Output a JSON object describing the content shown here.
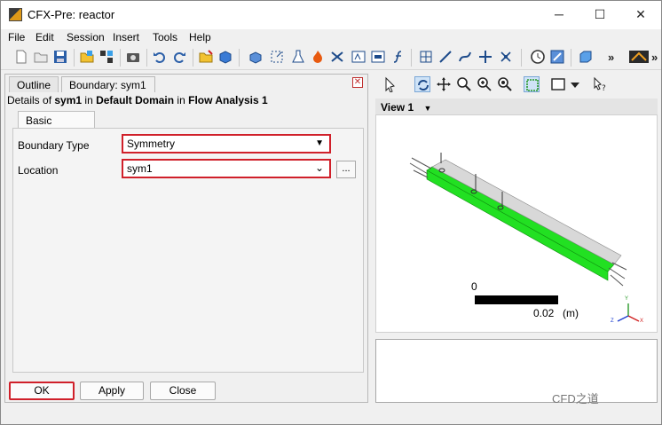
{
  "window": {
    "title": "CFX-Pre:  reactor",
    "minimize": "─",
    "maximize": "☐",
    "close": "✕"
  },
  "menu": [
    "File",
    "Edit",
    "Session",
    "Insert",
    "Tools",
    "Help"
  ],
  "toolbar": {
    "icons": [
      "new-file-icon",
      "open-folder-icon",
      "save-icon",
      "import-mesh-icon",
      "mesh-icon",
      "screenshot-icon",
      "undo-icon",
      "redo-icon",
      "open-results-icon",
      "package-icon",
      "domain-icon",
      "boundary-icon",
      "flask-icon",
      "flame-icon",
      "reaction-icon",
      "vector-icon",
      "subdomain-icon",
      "function-icon",
      "mesh-adapt-icon",
      "line-icon",
      "curve-icon",
      "point-icon",
      "transform-icon",
      "clock-icon",
      "solver-icon",
      "box-icon",
      "ansys-logo-icon"
    ],
    "more": "»"
  },
  "left": {
    "tabs": {
      "outline": "Outline",
      "boundary": "Boundary: sym1"
    },
    "close": "✕",
    "details": {
      "prefix": "Details of ",
      "object": "sym1",
      "in1": " in ",
      "domain": "Default Domain",
      "in2": " in ",
      "analysis": "Flow Analysis 1"
    },
    "inner_tab": "Basic Settings",
    "boundary_type_label": "Boundary Type",
    "boundary_type_value": "Symmetry",
    "location_label": "Location",
    "location_value": "sym1",
    "location_more": "...",
    "buttons": {
      "ok": "OK",
      "apply": "Apply",
      "close": "Close"
    }
  },
  "right": {
    "view_toolbar_icons": [
      "select-pointer-icon",
      "rotate-icon",
      "pan-icon",
      "zoom-icon",
      "zoom-box-icon",
      "zoom-fit-icon",
      "fit-view-icon",
      "view-box-icon",
      "dropdown-icon",
      "help-cursor-icon"
    ],
    "view_label": "View 1",
    "view_arrow": "▼",
    "scale": {
      "start": "0",
      "end": "0.02",
      "unit": "(m)"
    },
    "axis": {
      "x": "X",
      "y": "Y",
      "z": "Z"
    }
  },
  "watermark": "CFD之道",
  "colors": {
    "highlight": "#d0202a",
    "mesh_green": "#22e022",
    "accent": "#3a7bd5"
  }
}
